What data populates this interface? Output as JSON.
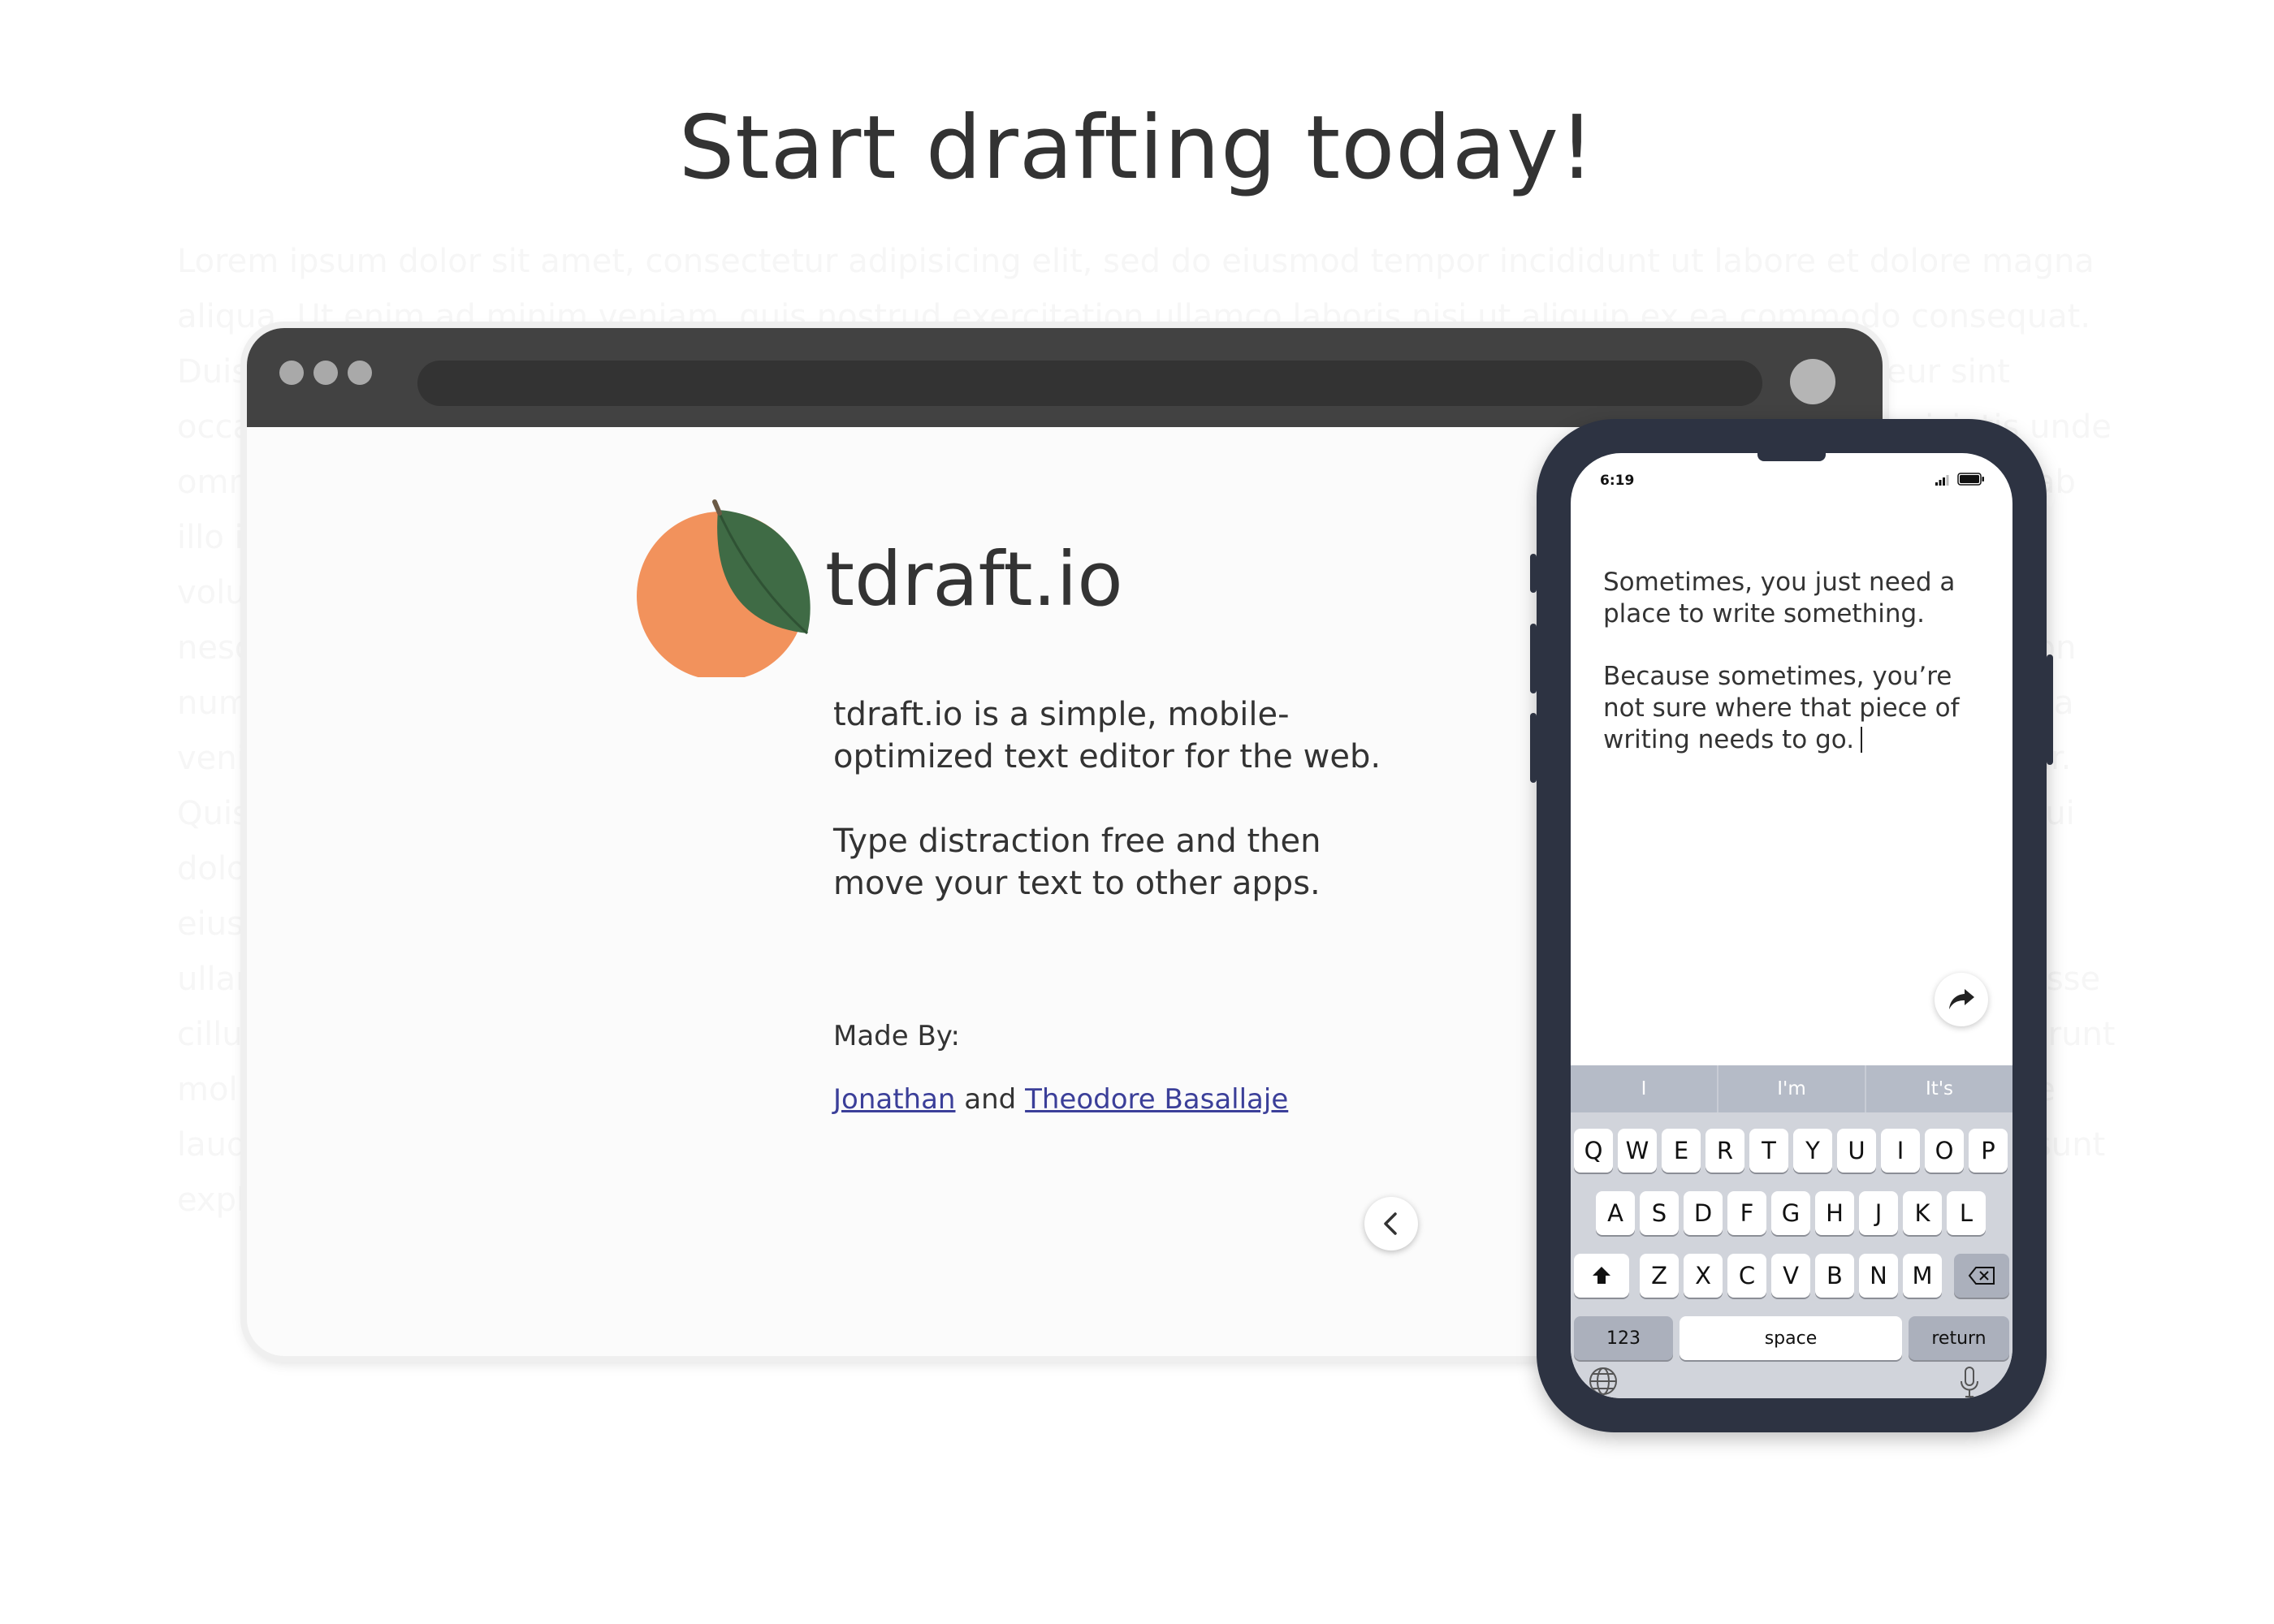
{
  "hero": {
    "title": "Start drafting today!"
  },
  "background_text": "Lorem ipsum dolor sit amet, consectetur adipisicing elit, sed do eiusmod tempor incididunt ut labore et dolore magna aliqua. Ut enim ad minim veniam, quis nostrud exercitation ullamco laboris nisi ut aliquip ex ea commodo consequat. Duis aute irure dolor in reprehenderit in voluptate velit esse cillum dolore eu fugiat nulla pariatur. Excepteur sint occaecat cupidatat non proident, sunt in culpa qui officia deserunt mollit anim id est laborum. Sed ut perspiciatis unde omnis iste natus error sit voluptatem accusantium doloremque laudantium, totam rem aperiam, eaque ipsa quae ab illo inventore veritatis et quasi architecto beatae vitae dicta sunt explicabo. Nemo enim ipsam voluptatem quia voluptas sit aspernatur aut odit aut fugit, sed quia consequuntur magni dolores eos qui ratione voluptatem sequi nesciunt. Neque porro quisquam est, qui dolorem ipsum quia dolor sit amet, consectetur, adipisci velit, sed quia non numquam eius modi tempora incidunt ut labore et dolore magnam aliquam quaerat voluptatem. Ut enim ad minima veniam, quis nostrum exercitationem ullam corporis suscipit laboriosam, nisi ut aliquid ex ea commodi consequatur. Quis autem vel eum iure reprehenderit qui in ea voluptate velit esse quam nihil molestiae consequatur, vel illum qui dolorem eum fugiat quo voluptas nulla pariatur. Lorem ipsum dolor sit amet, consectetur adipisicing elit, sed do eiusmod tempor incididunt ut labore et dolore magna aliqua. Ut enim ad minim veniam, quis nostrud exercitation ullamco laboris nisi ut aliquip ex ea commodo consequat. Duis aute irure dolor in reprehenderit in voluptate velit esse cillum dolore eu fugiat nulla pariatur. Excepteur sint occaecat cupidatat non proident, sunt in culpa qui officia deserunt mollit anim id est laborum. Sed ut perspiciatis unde omnis iste natus error sit voluptatem accusantium doloremque laudantium, totam rem aperiam, eaque ipsa quae ab illo inventore veritatis et quasi architecto beatae vitae dicta sunt explicabo. Nemo enim ipsam voluptatem quia voluptas sit",
  "browser": {
    "brand_name": "tdraft.io",
    "intro_paragraph_1": "tdraft.io is a simple, mobile-optimized text editor for the web.",
    "intro_paragraph_2": "Type distraction free and then move your text to other apps.",
    "made_by_label": "Made By:",
    "credits": {
      "author_1": "Jonathan",
      "conjunction": "and",
      "author_2": "Theodore Basallaje"
    },
    "back_button_icon": "chevron-left-icon"
  },
  "phone": {
    "status_time": "6:19",
    "editor_paragraph_1": "Sometimes, you just need a place to write something.",
    "editor_paragraph_2": "Because sometimes, you’re not sure where that piece of writing needs to go.",
    "share_button_icon": "share-arrow-icon",
    "keyboard": {
      "suggestions": [
        "I",
        "I'm",
        "It's"
      ],
      "row1": [
        "Q",
        "W",
        "E",
        "R",
        "T",
        "Y",
        "U",
        "I",
        "O",
        "P"
      ],
      "row2": [
        "A",
        "S",
        "D",
        "F",
        "G",
        "H",
        "J",
        "K",
        "L"
      ],
      "row3": [
        "Z",
        "X",
        "C",
        "V",
        "B",
        "N",
        "M"
      ],
      "numbers_key": "123",
      "space_key": "space",
      "return_key": "return"
    }
  },
  "colors": {
    "logo_orange": "#f2925c",
    "logo_leaf": "#3f6b45",
    "link": "#3b3f99",
    "browser_chrome": "#424242",
    "phone_frame": "#2d3342"
  }
}
